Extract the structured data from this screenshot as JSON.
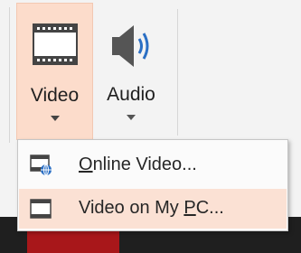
{
  "ribbon": {
    "video_button": {
      "label": "Video",
      "icon": "film-strip-icon"
    },
    "audio_button": {
      "label": "Audio",
      "icon": "speaker-icon"
    }
  },
  "menu": {
    "items": [
      {
        "label_pre": "",
        "label_key": "O",
        "label_post": "nline Video...",
        "icon": "online-video-icon"
      },
      {
        "label_pre": "Video on My ",
        "label_key": "P",
        "label_post": "C...",
        "icon": "film-strip-icon"
      }
    ]
  },
  "colors": {
    "selected_bg": "#fcdccb",
    "menu_hover_bg": "#fbe1d4",
    "accent_blue": "#2b6fc4"
  }
}
